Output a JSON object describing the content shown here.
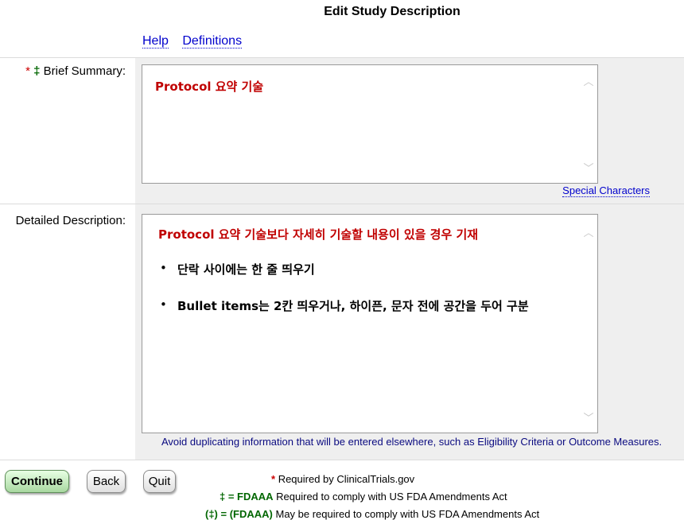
{
  "page": {
    "title": "Edit Study Description"
  },
  "links": {
    "help": "Help",
    "definitions": "Definitions",
    "special_characters": "Special Characters"
  },
  "brief_summary": {
    "required_mark": "*",
    "fdaaa_mark": "‡",
    "label": "Brief Summary:",
    "value": "Protocol 요약 기술"
  },
  "detailed_description": {
    "label": "Detailed Description:",
    "lines": [
      "Protocol 요약 기술보다 자세히 기술할 내용이 있을 경우 기재",
      "단락 사이에는 한 줄 띄우기",
      "Bullet items는 2칸 띄우거나, 하이픈, 문자 전에 공간을 두어 구분"
    ],
    "bullet": "•",
    "note": "Avoid duplicating information that will be entered elsewhere, such as Eligibility Criteria or Outcome Measures."
  },
  "buttons": {
    "continue": "Continue",
    "back": "Back",
    "quit": "Quit"
  },
  "legend": [
    {
      "key": "*",
      "text": "Required by ClinicalTrials.gov"
    },
    {
      "key": "‡ = FDAAA",
      "text": "Required to comply with US FDA Amendments Act"
    },
    {
      "key": "(‡) = (FDAAA)",
      "text": "May be required to comply with US FDA Amendments Act"
    }
  ],
  "colors": {
    "required": "#cc0000",
    "fdaaa": "#006600",
    "link": "#0000cc",
    "korean_text": "#c00000"
  }
}
